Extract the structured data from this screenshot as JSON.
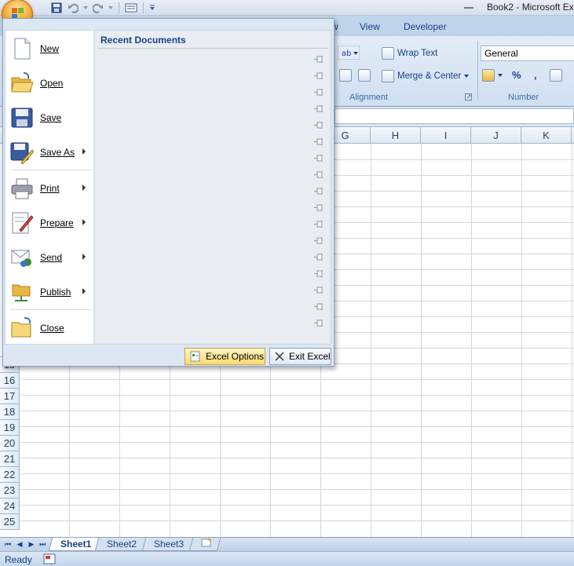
{
  "window": {
    "title": "Book2 - Microsoft Ex"
  },
  "ribbon": {
    "tabs": [
      {
        "label": "w"
      },
      {
        "label": "View"
      },
      {
        "label": "Developer"
      }
    ],
    "wrap_text": "Wrap Text",
    "merge_center": "Merge & Center",
    "number_format": "General",
    "percent": "%",
    "comma": ",",
    "groups": {
      "alignment": "Alignment",
      "number": "Number"
    }
  },
  "grid": {
    "columns": [
      "G",
      "H",
      "I",
      "J",
      "K"
    ],
    "rows": [
      "15",
      "16",
      "17",
      "18",
      "19",
      "20",
      "21",
      "22",
      "23",
      "24",
      "25"
    ]
  },
  "sheets": {
    "tabs": [
      "Sheet1",
      "Sheet2",
      "Sheet3"
    ],
    "active": "Sheet1"
  },
  "status": {
    "text": "Ready"
  },
  "office_menu": {
    "recent_title": "Recent Documents",
    "items": [
      {
        "label": "New",
        "icon": "new-document-icon"
      },
      {
        "label": "Open",
        "icon": "open-folder-icon"
      },
      {
        "label": "Save",
        "icon": "save-disk-icon"
      },
      {
        "label": "Save As",
        "icon": "save-as-icon"
      },
      {
        "label": "Print",
        "icon": "printer-icon"
      },
      {
        "label": "Prepare",
        "icon": "prepare-icon"
      },
      {
        "label": "Send",
        "icon": "send-icon"
      },
      {
        "label": "Publish",
        "icon": "publish-icon"
      },
      {
        "label": "Close",
        "icon": "close-folder-icon"
      }
    ],
    "excel_options": "Excel Options",
    "exit_excel": "Exit Excel"
  }
}
